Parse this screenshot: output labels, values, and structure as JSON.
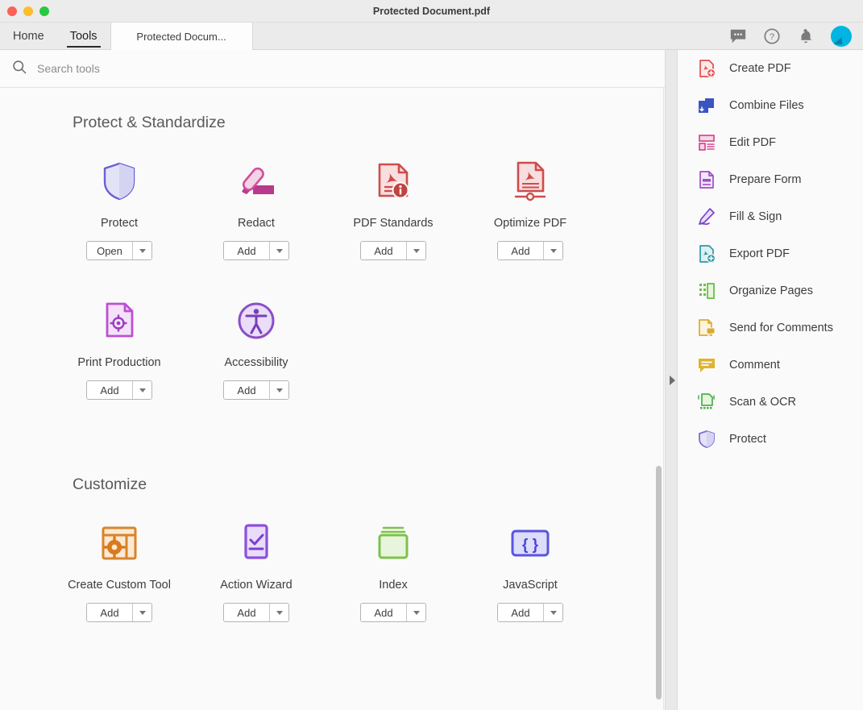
{
  "window": {
    "title": "Protected Document.pdf",
    "traffic_lights": [
      "close",
      "minimize",
      "maximize"
    ]
  },
  "tabbar": {
    "tabs": [
      {
        "label": "Home",
        "active": false
      },
      {
        "label": "Tools",
        "active": true
      }
    ],
    "document_tab": "Protected Docum...",
    "icons": [
      "comment-icon",
      "help-icon",
      "bell-icon",
      "avatar"
    ]
  },
  "search": {
    "placeholder": "Search tools",
    "value": "",
    "icon": "search-icon"
  },
  "sections": [
    {
      "title": "Protect & Standardize",
      "tools": [
        {
          "label": "Protect",
          "button": "Open",
          "icon": "shield-icon"
        },
        {
          "label": "Redact",
          "button": "Add",
          "icon": "marker-icon"
        },
        {
          "label": "PDF Standards",
          "button": "Add",
          "icon": "pdf-info-icon"
        },
        {
          "label": "Optimize PDF",
          "button": "Add",
          "icon": "pdf-slider-icon"
        },
        {
          "label": "Print Production",
          "button": "Add",
          "icon": "print-target-icon"
        },
        {
          "label": "Accessibility",
          "button": "Add",
          "icon": "accessibility-icon"
        }
      ]
    },
    {
      "title": "Customize",
      "tools": [
        {
          "label": "Create Custom Tool",
          "button": "Add",
          "icon": "custom-tool-icon"
        },
        {
          "label": "Action Wizard",
          "button": "Add",
          "icon": "action-wizard-icon"
        },
        {
          "label": "Index",
          "button": "Add",
          "icon": "index-icon"
        },
        {
          "label": "JavaScript",
          "button": "Add",
          "icon": "javascript-icon"
        }
      ]
    }
  ],
  "sidebar": {
    "items": [
      {
        "label": "Create PDF",
        "icon": "create-pdf-icon",
        "color": "#e34f4f"
      },
      {
        "label": "Combine Files",
        "icon": "combine-files-icon",
        "color": "#3b54c4"
      },
      {
        "label": "Edit PDF",
        "icon": "edit-pdf-icon",
        "color": "#d4478f"
      },
      {
        "label": "Prepare Form",
        "icon": "prepare-form-icon",
        "color": "#9b4fc4"
      },
      {
        "label": "Fill & Sign",
        "icon": "fill-sign-icon",
        "color": "#7a43c9"
      },
      {
        "label": "Export PDF",
        "icon": "export-pdf-icon",
        "color": "#2e9aa8"
      },
      {
        "label": "Organize Pages",
        "icon": "organize-pages-icon",
        "color": "#6bbf45"
      },
      {
        "label": "Send for Comments",
        "icon": "send-comments-icon",
        "color": "#d9ab2c"
      },
      {
        "label": "Comment",
        "icon": "comment-icon",
        "color": "#e0b32e"
      },
      {
        "label": "Scan & OCR",
        "icon": "scan-ocr-icon",
        "color": "#4fae4a"
      },
      {
        "label": "Protect",
        "icon": "protect-shield-icon",
        "color": "#7b6fd0"
      }
    ]
  },
  "scrollbar": {
    "name": "vertical-scrollbar"
  },
  "divider": {
    "expander_icon": "expand-right-arrow"
  },
  "colors": {
    "window_chrome": "#ececec",
    "panel_background": "#fafafa",
    "active_tab_underline": "#2b2b2b",
    "avatar": "#00b5e2"
  }
}
